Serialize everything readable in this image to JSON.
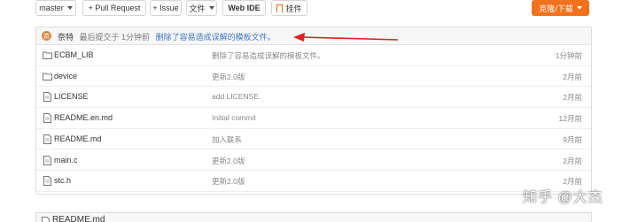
{
  "toolbar": {
    "branch": "master",
    "pull_request": "+ Pull Request",
    "issue": "+ Issue",
    "file_menu": "文件",
    "web_ide": "Web IDE",
    "plugin": "挂件",
    "clone": "克隆/下载"
  },
  "commit": {
    "author": "奈特",
    "meta": "最后提交于 1分钟前",
    "message": "删除了容易造成误解的模板文件。"
  },
  "files": [
    {
      "name": "ECBM_LIB",
      "type": "folder",
      "message": "删除了容易造成误解的模板文件。",
      "time": "1分钟前"
    },
    {
      "name": "device",
      "type": "folder",
      "message": "更新2.0版",
      "time": "2月前"
    },
    {
      "name": "LICENSE",
      "type": "file",
      "message": "add LICENSE.",
      "time": "2月前"
    },
    {
      "name": "README.en.md",
      "type": "file",
      "message": "Initial commit",
      "time": "12月前"
    },
    {
      "name": "README.md",
      "type": "file",
      "message": "加入联系",
      "time": "9月前"
    },
    {
      "name": "main.c",
      "type": "file",
      "message": "更新2.0版",
      "time": "2月前"
    },
    {
      "name": "stc.h",
      "type": "file",
      "message": "更新2.0版",
      "time": "2月前"
    }
  ],
  "readme": {
    "label": "README.md"
  },
  "watermark": "知乎 @大杰",
  "colors": {
    "accent": "#f2711c",
    "link": "#4078c0",
    "arrow": "#e02020"
  }
}
